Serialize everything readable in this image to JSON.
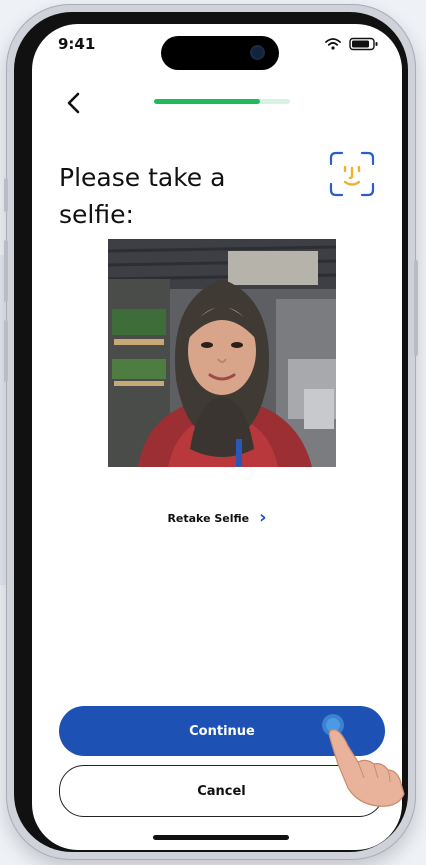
{
  "status_bar": {
    "time": "9:41",
    "icons": [
      "wifi-icon",
      "battery-icon"
    ]
  },
  "header": {
    "back_icon": "chevron-left-icon",
    "progress_fraction": 0.78
  },
  "main": {
    "title": "Please take a selfie:",
    "face_icon": "face-scan-icon",
    "selfie_alt": "selfie-photo",
    "retake_label": "Retake Selfie",
    "retake_icon": "chevron-right-icon"
  },
  "actions": {
    "continue_label": "Continue",
    "cancel_label": "Cancel"
  },
  "colors": {
    "primary": "#1d52b4",
    "progress": "#1fbb5a",
    "face_icon": "#2b5ec9",
    "face_smile": "#f0b12d"
  }
}
